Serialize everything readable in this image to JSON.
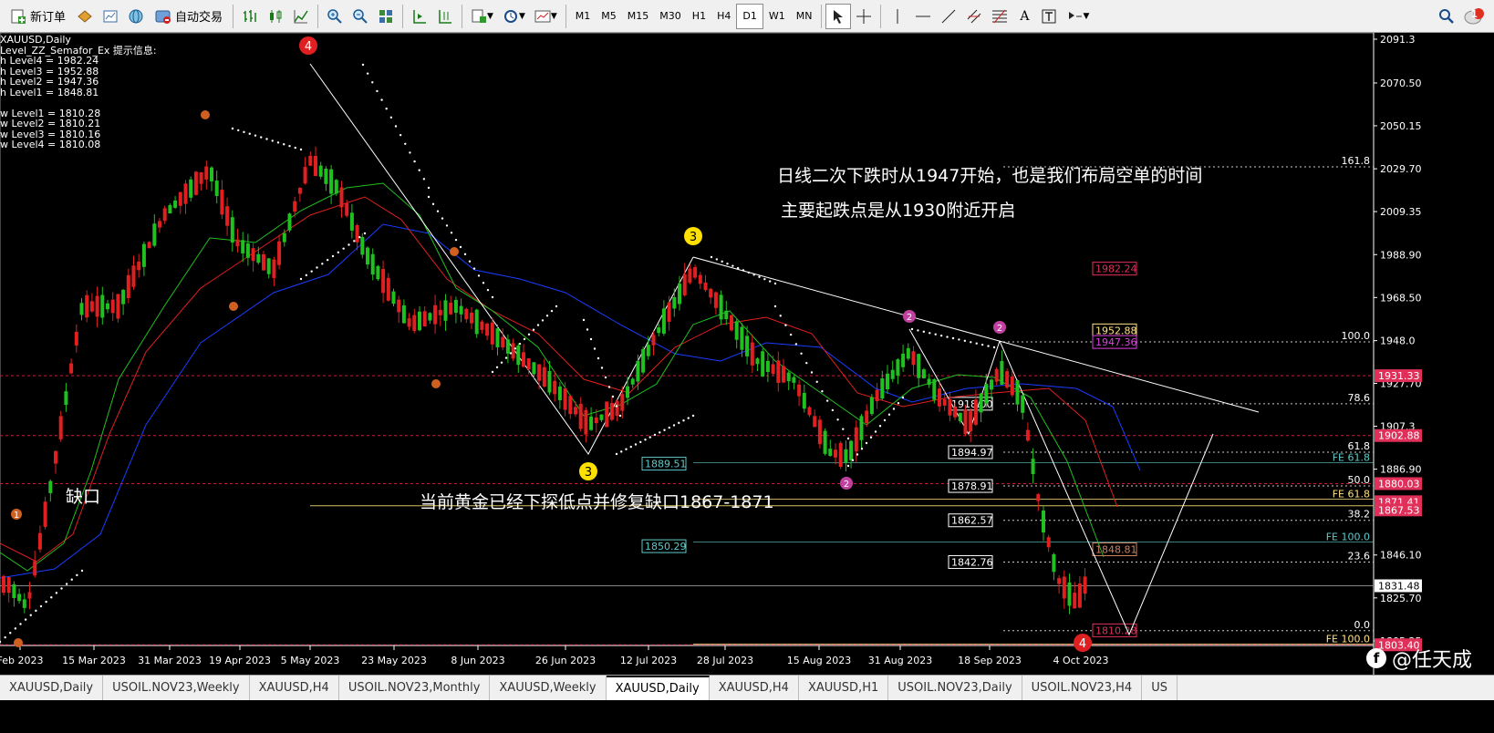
{
  "toolbar": {
    "new_order": "新订单",
    "auto_trade": "自动交易",
    "timeframes": [
      "M1",
      "M5",
      "M15",
      "M30",
      "H1",
      "H4",
      "D1",
      "W1",
      "MN"
    ],
    "active_timeframe": "D1",
    "notification_count": "1"
  },
  "info": {
    "symbol": "XAUUSD,Daily",
    "indicator": "Level_ZZ_Semafor_Ex 提示信息:",
    "high_levels": [
      "h Level4 = 1982.24",
      "h Level3 = 1952.88",
      "h Level2 = 1947.36",
      "h Level1 = 1848.81"
    ],
    "low_levels": [
      "w Level1 = 1810.28",
      "w Level2 = 1810.21",
      "w Level3 = 1810.16",
      "w Level4 = 1810.08"
    ]
  },
  "annotations": {
    "line1": "日线二次下跌时从1947开始，也是我们布局空单的时间",
    "line2": "主要起跌点是从1930附近开启",
    "gap": "缺口",
    "repair": "当前黄金已经下探低点并修复缺口1867-1871"
  },
  "chart_data": {
    "type": "candlestick",
    "symbol": "XAUUSD",
    "timeframe": "Daily",
    "price_axis_ticks": [
      2091.3,
      2070.5,
      2050.15,
      2029.7,
      2009.35,
      1988.9,
      1968.5,
      1948.0,
      1927.7,
      1907.3,
      1886.9,
      1846.1,
      1825.7,
      1805.25
    ],
    "date_ticks": [
      "Feb 2023",
      "15 Mar 2023",
      "31 Mar 2023",
      "19 Apr 2023",
      "5 May 2023",
      "23 May 2023",
      "8 Jun 2023",
      "26 Jun 2023",
      "12 Jul 2023",
      "28 Jul 2023",
      "15 Aug 2023",
      "31 Aug 2023",
      "18 Sep 2023",
      "4 Oct 2023"
    ],
    "axis_price_boxes": [
      {
        "label": "1931.33",
        "price": 1931.33,
        "color": "#e0305a"
      },
      {
        "label": "1902.88",
        "price": 1902.88,
        "color": "#e0305a"
      },
      {
        "label": "1880.03",
        "price": 1880.03,
        "color": "#e0305a"
      },
      {
        "label": "1871.41",
        "price": 1871.41,
        "color": "#e0305a"
      },
      {
        "label": "1867.53",
        "price": 1867.53,
        "color": "#e0305a"
      },
      {
        "label": "1831.48",
        "price": 1831.48,
        "color": "#ffffff"
      },
      {
        "label": "1803.40",
        "price": 1803.4,
        "color": "#e0305a"
      }
    ],
    "fib_levels": [
      {
        "label": "161.8",
        "price": 2030.6
      },
      {
        "label": "100.0",
        "price": 1947.4
      },
      {
        "label": "78.6",
        "price": 1918.0
      },
      {
        "label": "61.8",
        "price": 1894.97
      },
      {
        "label": "50.0",
        "price": 1878.91
      },
      {
        "label": "38.2",
        "price": 1862.57
      },
      {
        "label": "23.6",
        "price": 1842.76
      },
      {
        "label": "0.0",
        "price": 1810.1
      }
    ],
    "fe_levels": [
      {
        "label": "FE 61.8",
        "price": 1890.0,
        "color": "#5fc9c9"
      },
      {
        "label": "FE 61.8",
        "price": 1872.6,
        "color": "#ffe082"
      },
      {
        "label": "FE 100.0",
        "price": 1852.2,
        "color": "#5fc9c9"
      },
      {
        "label": "FE 100.0",
        "price": 1803.8,
        "color": "#ffe082"
      }
    ],
    "chart_price_labels": [
      {
        "label": "1982.24",
        "price": 1982.24,
        "color": "#e0305a"
      },
      {
        "label": "1952.88",
        "price": 1952.88,
        "color": "#ffe082"
      },
      {
        "label": "1947.36",
        "price": 1947.36,
        "color": "#e040e0"
      },
      {
        "label": "1918.00",
        "price": 1918.0,
        "color": "#ffffff"
      },
      {
        "label": "1894.97",
        "price": 1894.97,
        "color": "#ffffff"
      },
      {
        "label": "1878.91",
        "price": 1878.91,
        "color": "#ffffff"
      },
      {
        "label": "1862.57",
        "price": 1862.57,
        "color": "#ffffff"
      },
      {
        "label": "1842.76",
        "price": 1842.76,
        "color": "#ffffff"
      },
      {
        "label": "1889.51",
        "price": 1889.51,
        "color": "#5fc9c9"
      },
      {
        "label": "1850.29",
        "price": 1850.29,
        "color": "#5fc9c9"
      },
      {
        "label": "1848.81",
        "price": 1848.81,
        "color": "#d08060"
      },
      {
        "label": "1810.28",
        "price": 1810.28,
        "color": "#e0305a"
      }
    ],
    "semafor_markers": [
      {
        "label": "4",
        "color": "#e02020"
      },
      {
        "label": "3",
        "color": "#ffe000"
      },
      {
        "label": "3",
        "color": "#ffe000"
      },
      {
        "label": "2",
        "color": "#c040a0"
      },
      {
        "label": "2",
        "color": "#c040a0"
      },
      {
        "label": "2",
        "color": "#c040a0"
      },
      {
        "label": "4",
        "color": "#e02020"
      },
      {
        "label": "1",
        "color": "#d06020"
      }
    ]
  },
  "tabs": [
    "XAUUSD,Daily",
    "USOIL.NOV23,Weekly",
    "XAUUSD,H4",
    "USOIL.NOV23,Monthly",
    "XAUUSD,Weekly",
    "XAUUSD,Daily",
    "XAUUSD,H4",
    "XAUUSD,H1",
    "USOIL.NOV23,Daily",
    "USOIL.NOV23,H4",
    "US"
  ],
  "active_tab_index": 5,
  "watermark": "@任天成"
}
